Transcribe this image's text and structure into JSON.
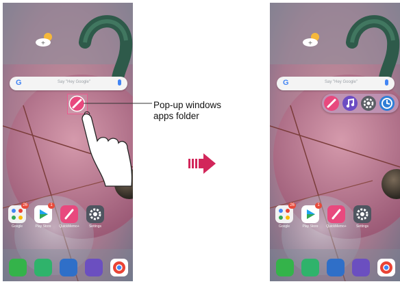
{
  "callout": {
    "line1": "Pop-up windows",
    "line2": "apps folder"
  },
  "search": {
    "g_letter": "G",
    "hint": "Say \"Hey Google\""
  },
  "apps": [
    {
      "name": "Google",
      "icon": "google-folder-icon",
      "badge": "26"
    },
    {
      "name": "Play Store",
      "icon": "play-store-icon",
      "badge": "1"
    },
    {
      "name": "QuickMemo+",
      "icon": "pen-icon",
      "badge": ""
    },
    {
      "name": "Settings",
      "icon": "gear-icon",
      "badge": ""
    }
  ],
  "dock": [
    {
      "icon": "phone-icon",
      "color": "#34b34a"
    },
    {
      "icon": "messages-icon",
      "color": "#2fb36b"
    },
    {
      "icon": "camera-icon",
      "color": "#2f6fc8"
    },
    {
      "icon": "gallery-icon",
      "color": "#6b4fc0"
    },
    {
      "icon": "chrome-icon",
      "color": "#ffffff"
    }
  ],
  "popup": [
    {
      "icon": "pen-icon",
      "color": "#e8497e"
    },
    {
      "icon": "music-icon",
      "color": "#6c4cc3"
    },
    {
      "icon": "gear-icon",
      "color": "#5b5f66"
    },
    {
      "icon": "clock-icon",
      "color": "#2f7fd6"
    }
  ],
  "colors": {
    "accent": "#e8497e",
    "arrow": "#d2265a",
    "wallpaper": "#b98a9a"
  }
}
